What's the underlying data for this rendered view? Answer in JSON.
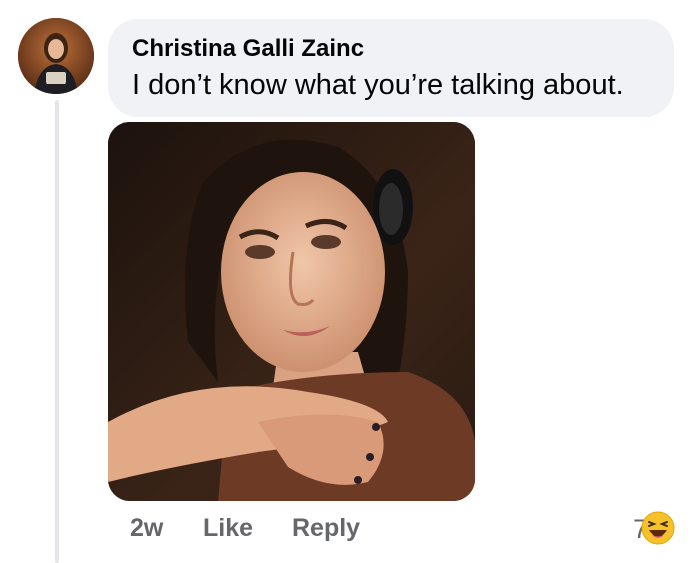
{
  "comment": {
    "author": "Christina Galli Zainc",
    "text": "I don’t know what you’re talking about."
  },
  "actions": {
    "time": "2w",
    "like": "Like",
    "reply": "Reply"
  },
  "reaction": {
    "count": "7",
    "icon": "laughing-emoji-icon"
  }
}
